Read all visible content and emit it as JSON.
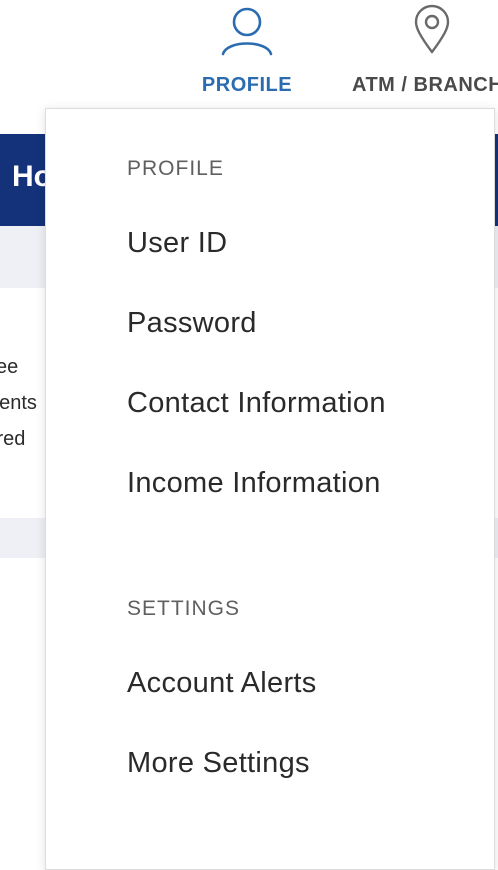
{
  "nav": {
    "profile": {
      "label": "PROFILE",
      "icon": "user-icon",
      "active": true
    },
    "atm": {
      "label": "ATM / BRANCH",
      "icon": "location-pin-icon"
    }
  },
  "background": {
    "hero_text": "Ho",
    "snippets": [
      "ee",
      "nents",
      "ired"
    ]
  },
  "dropdown": {
    "profile_header": "PROFILE",
    "profile_items": [
      "User ID",
      "Password",
      "Contact Information",
      "Income Information"
    ],
    "settings_header": "SETTINGS",
    "settings_items": [
      "Account Alerts",
      "More Settings"
    ]
  },
  "colors": {
    "accent": "#2b6cb0",
    "hero_bg": "#14327a",
    "band_bg": "#eef0f5"
  }
}
